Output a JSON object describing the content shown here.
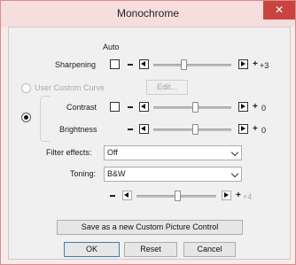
{
  "window": {
    "title": "Monochrome",
    "close_glyph": "✕"
  },
  "sharpening": {
    "column_header": "Auto",
    "label": "Sharpening",
    "value": "+3",
    "auto_checked": false,
    "slider_percent": 55
  },
  "custom_curve": {
    "label": "User Custom Curve",
    "edit_label": "Edit...",
    "selected": false
  },
  "contrast": {
    "label": "Contrast",
    "value": "0",
    "auto_checked": false,
    "slider_percent": 52
  },
  "brightness": {
    "label": "Brightness",
    "value": "0",
    "slider_percent": 52
  },
  "filter_effects": {
    "label": "Filter effects:",
    "value": "Off"
  },
  "toning": {
    "label": "Toning:",
    "value": "B&W",
    "value_stepper": "+4",
    "slider_percent": 48
  },
  "minus_glyph": "–",
  "plus_glyph": "+",
  "actions": {
    "save_custom": "Save as a new Custom Picture Control",
    "ok": "OK",
    "reset": "Reset",
    "cancel": "Cancel"
  },
  "colors": {
    "close_red": "#c9443f",
    "frame_pink": "#fbeaea",
    "client_gray": "#f0f0f0"
  }
}
